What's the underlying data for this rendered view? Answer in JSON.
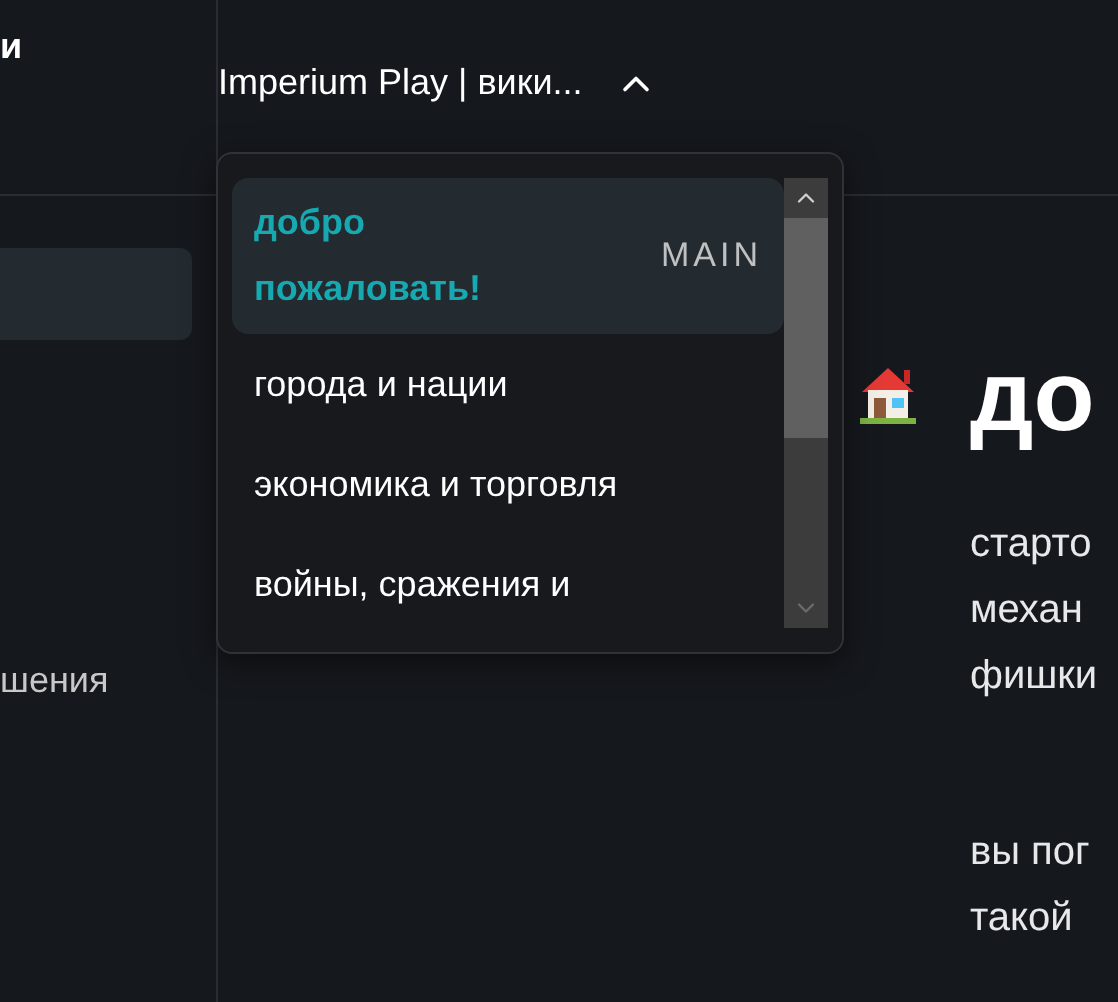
{
  "sidebar": {
    "title": "и",
    "items": [
      {
        "selected": true
      },
      {
        "label": "шения",
        "selected": false
      }
    ]
  },
  "header": {
    "title": "Imperium Play | вики...",
    "menu_expanded": true
  },
  "dropdown": {
    "items": [
      {
        "label": "добро пожаловать!",
        "badge": "MAIN",
        "selected": true
      },
      {
        "label": "города и нации",
        "selected": false
      },
      {
        "label": "экономика и торговля",
        "selected": false
      },
      {
        "label": "войны, сражения и",
        "selected": false
      }
    ]
  },
  "content": {
    "heading": "до",
    "paragraphs": [
      [
        "старто",
        "механ",
        "фишки"
      ],
      [
        "вы пог",
        "такой"
      ]
    ]
  }
}
